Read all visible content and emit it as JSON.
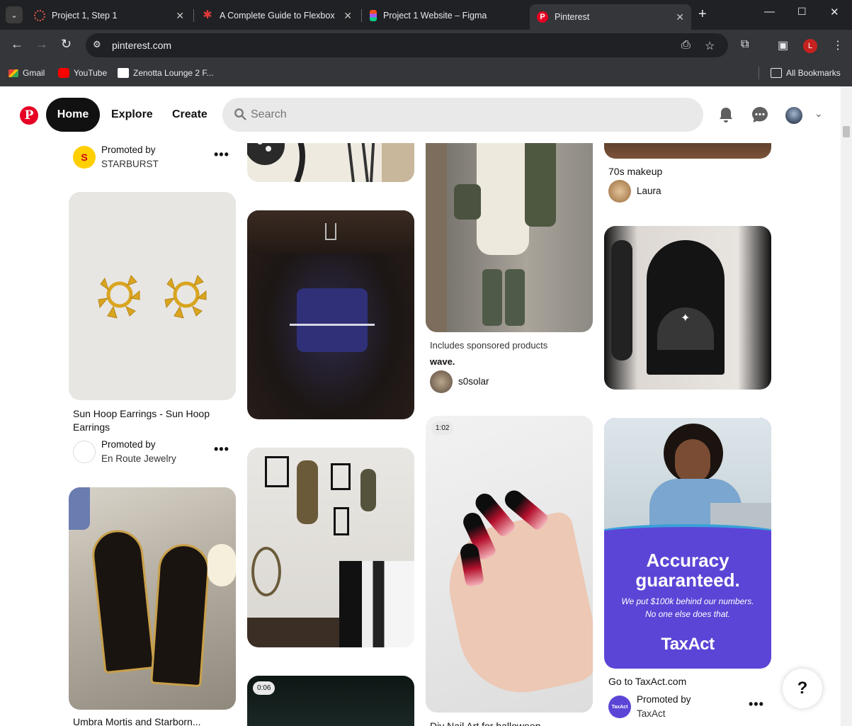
{
  "browser": {
    "tabs": [
      {
        "title": "Project 1, Step 1",
        "color": "#e05a47"
      },
      {
        "title": "A Complete Guide to Flexbox |",
        "color": "#e03a3a"
      },
      {
        "title": "Project 1 Website – Figma",
        "color": "#a259ff"
      },
      {
        "title": "Pinterest",
        "color": "#e60023"
      }
    ],
    "url": "pinterest.com",
    "profile_initial": "L",
    "bookmarks": [
      {
        "label": "Gmail"
      },
      {
        "label": "YouTube"
      },
      {
        "label": "Zenotta Lounge 2 F..."
      }
    ],
    "all_bookmarks": "All Bookmarks"
  },
  "header": {
    "logo": "P",
    "nav": {
      "home": "Home",
      "explore": "Explore",
      "create": "Create"
    },
    "search_placeholder": "Search"
  },
  "pins": {
    "col1": {
      "top_meta": {
        "label": "Promoted by",
        "name": "STARBURST",
        "avatar_letter": "S"
      },
      "earrings": {
        "title": "Sun Hoop Earrings - Sun Hoop Earrings",
        "meta_label": "Promoted by",
        "meta_name": "En Route Jewelry"
      },
      "tarot": {
        "title": "Umbra Mortis and Starborn..."
      }
    },
    "col2": {
      "video_badge": "0:06"
    },
    "col3": {
      "outfit": {
        "note": "Includes sponsored products",
        "title": "wave.",
        "user": "s0solar"
      },
      "nails": {
        "badge": "1:02",
        "title": "Diy Nail Art for halloween"
      }
    },
    "col4": {
      "makeup": {
        "title": "70s makeup",
        "user": "Laura"
      },
      "ad": {
        "headline1": "Accuracy",
        "headline2": "guaranteed.",
        "sub1": "We put $100k behind our numbers.",
        "sub2": "No one else does that.",
        "brand": "TaxAct",
        "title": "Go to TaxAct.com",
        "meta_label": "Promoted by",
        "meta_name": "TaxAct",
        "avatar_text": "TaxAct"
      }
    }
  },
  "help_label": "?",
  "more_label": "•••",
  "colors": {
    "brand": "#e60023",
    "ad_purple": "#5b45d6"
  }
}
